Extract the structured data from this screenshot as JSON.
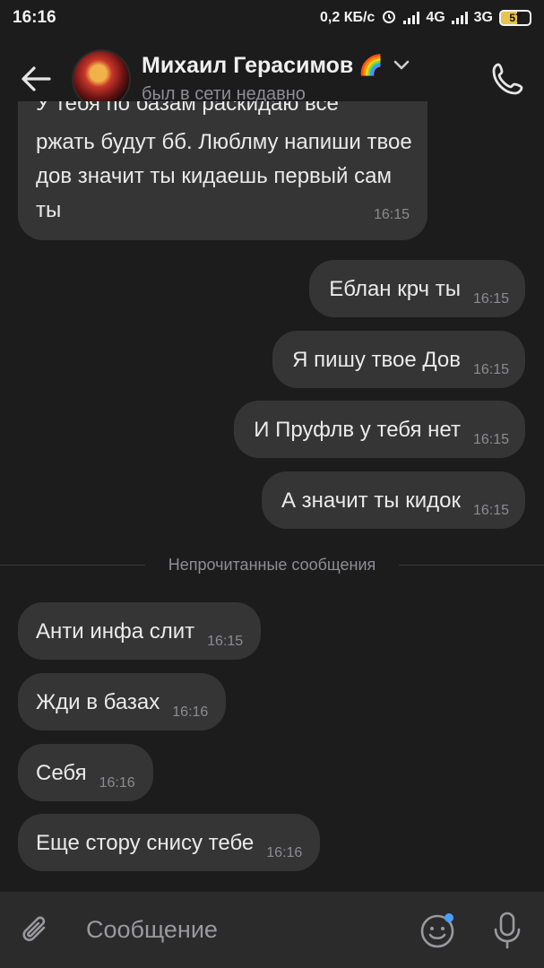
{
  "status_bar": {
    "time": "16:16",
    "speed": "0,2 КБ/с",
    "net1": "4G",
    "net2": "3G",
    "battery": "57"
  },
  "header": {
    "contact_name": "Михаил Герасимов",
    "name_emoji": "🌈",
    "contact_status": "был в сети недавно",
    "icons": [
      "back-arrow-icon",
      "chevron-down-icon",
      "phone-icon"
    ]
  },
  "messages": {
    "top_partial": {
      "clipped_line": "У тебя по базам раскидаю все",
      "text": "ржать будут бб. Люблму напиши твое дов значит ты кидаешь первый сам ты",
      "time": "16:15"
    },
    "outgoing": [
      {
        "text": "Еблан крч ты",
        "time": "16:15"
      },
      {
        "text": "Я пишу твое Дов",
        "time": "16:15"
      },
      {
        "text": "И Пруфлв у тебя нет",
        "time": "16:15"
      },
      {
        "text": "А значит ты кидок",
        "time": "16:15"
      }
    ],
    "unread_divider": "Непрочитанные сообщения",
    "incoming": [
      {
        "text": "Анти инфа слит",
        "time": "16:15"
      },
      {
        "text": "Жди в базах",
        "time": "16:16"
      },
      {
        "text": "Себя",
        "time": "16:16"
      },
      {
        "text": "Еще стору снису тебе",
        "time": "16:16"
      }
    ]
  },
  "composer": {
    "placeholder": "Сообщение",
    "icons": [
      "paperclip-icon",
      "emoji-icon",
      "microphone-icon"
    ],
    "accent_color": "#4a9eff"
  }
}
